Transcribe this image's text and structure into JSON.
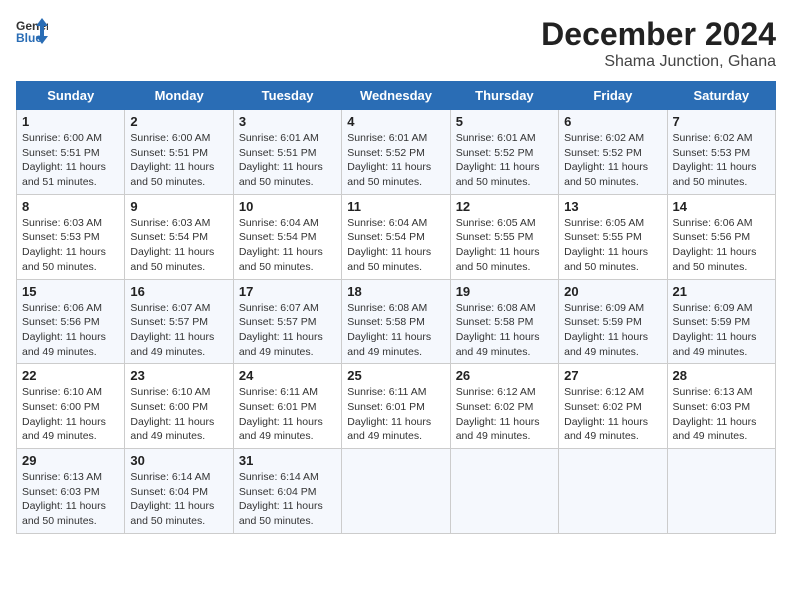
{
  "header": {
    "logo_line1": "General",
    "logo_line2": "Blue",
    "title": "December 2024",
    "subtitle": "Shama Junction, Ghana"
  },
  "days_of_week": [
    "Sunday",
    "Monday",
    "Tuesday",
    "Wednesday",
    "Thursday",
    "Friday",
    "Saturday"
  ],
  "weeks": [
    [
      {
        "day": 1,
        "sunrise": "6:00 AM",
        "sunset": "5:51 PM",
        "daylight": "11 hours and 51 minutes"
      },
      {
        "day": 2,
        "sunrise": "6:00 AM",
        "sunset": "5:51 PM",
        "daylight": "11 hours and 50 minutes"
      },
      {
        "day": 3,
        "sunrise": "6:01 AM",
        "sunset": "5:51 PM",
        "daylight": "11 hours and 50 minutes"
      },
      {
        "day": 4,
        "sunrise": "6:01 AM",
        "sunset": "5:52 PM",
        "daylight": "11 hours and 50 minutes"
      },
      {
        "day": 5,
        "sunrise": "6:01 AM",
        "sunset": "5:52 PM",
        "daylight": "11 hours and 50 minutes"
      },
      {
        "day": 6,
        "sunrise": "6:02 AM",
        "sunset": "5:52 PM",
        "daylight": "11 hours and 50 minutes"
      },
      {
        "day": 7,
        "sunrise": "6:02 AM",
        "sunset": "5:53 PM",
        "daylight": "11 hours and 50 minutes"
      }
    ],
    [
      {
        "day": 8,
        "sunrise": "6:03 AM",
        "sunset": "5:53 PM",
        "daylight": "11 hours and 50 minutes"
      },
      {
        "day": 9,
        "sunrise": "6:03 AM",
        "sunset": "5:54 PM",
        "daylight": "11 hours and 50 minutes"
      },
      {
        "day": 10,
        "sunrise": "6:04 AM",
        "sunset": "5:54 PM",
        "daylight": "11 hours and 50 minutes"
      },
      {
        "day": 11,
        "sunrise": "6:04 AM",
        "sunset": "5:54 PM",
        "daylight": "11 hours and 50 minutes"
      },
      {
        "day": 12,
        "sunrise": "6:05 AM",
        "sunset": "5:55 PM",
        "daylight": "11 hours and 50 minutes"
      },
      {
        "day": 13,
        "sunrise": "6:05 AM",
        "sunset": "5:55 PM",
        "daylight": "11 hours and 50 minutes"
      },
      {
        "day": 14,
        "sunrise": "6:06 AM",
        "sunset": "5:56 PM",
        "daylight": "11 hours and 50 minutes"
      }
    ],
    [
      {
        "day": 15,
        "sunrise": "6:06 AM",
        "sunset": "5:56 PM",
        "daylight": "11 hours and 49 minutes"
      },
      {
        "day": 16,
        "sunrise": "6:07 AM",
        "sunset": "5:57 PM",
        "daylight": "11 hours and 49 minutes"
      },
      {
        "day": 17,
        "sunrise": "6:07 AM",
        "sunset": "5:57 PM",
        "daylight": "11 hours and 49 minutes"
      },
      {
        "day": 18,
        "sunrise": "6:08 AM",
        "sunset": "5:58 PM",
        "daylight": "11 hours and 49 minutes"
      },
      {
        "day": 19,
        "sunrise": "6:08 AM",
        "sunset": "5:58 PM",
        "daylight": "11 hours and 49 minutes"
      },
      {
        "day": 20,
        "sunrise": "6:09 AM",
        "sunset": "5:59 PM",
        "daylight": "11 hours and 49 minutes"
      },
      {
        "day": 21,
        "sunrise": "6:09 AM",
        "sunset": "5:59 PM",
        "daylight": "11 hours and 49 minutes"
      }
    ],
    [
      {
        "day": 22,
        "sunrise": "6:10 AM",
        "sunset": "6:00 PM",
        "daylight": "11 hours and 49 minutes"
      },
      {
        "day": 23,
        "sunrise": "6:10 AM",
        "sunset": "6:00 PM",
        "daylight": "11 hours and 49 minutes"
      },
      {
        "day": 24,
        "sunrise": "6:11 AM",
        "sunset": "6:01 PM",
        "daylight": "11 hours and 49 minutes"
      },
      {
        "day": 25,
        "sunrise": "6:11 AM",
        "sunset": "6:01 PM",
        "daylight": "11 hours and 49 minutes"
      },
      {
        "day": 26,
        "sunrise": "6:12 AM",
        "sunset": "6:02 PM",
        "daylight": "11 hours and 49 minutes"
      },
      {
        "day": 27,
        "sunrise": "6:12 AM",
        "sunset": "6:02 PM",
        "daylight": "11 hours and 49 minutes"
      },
      {
        "day": 28,
        "sunrise": "6:13 AM",
        "sunset": "6:03 PM",
        "daylight": "11 hours and 49 minutes"
      }
    ],
    [
      {
        "day": 29,
        "sunrise": "6:13 AM",
        "sunset": "6:03 PM",
        "daylight": "11 hours and 50 minutes"
      },
      {
        "day": 30,
        "sunrise": "6:14 AM",
        "sunset": "6:04 PM",
        "daylight": "11 hours and 50 minutes"
      },
      {
        "day": 31,
        "sunrise": "6:14 AM",
        "sunset": "6:04 PM",
        "daylight": "11 hours and 50 minutes"
      },
      null,
      null,
      null,
      null
    ]
  ]
}
